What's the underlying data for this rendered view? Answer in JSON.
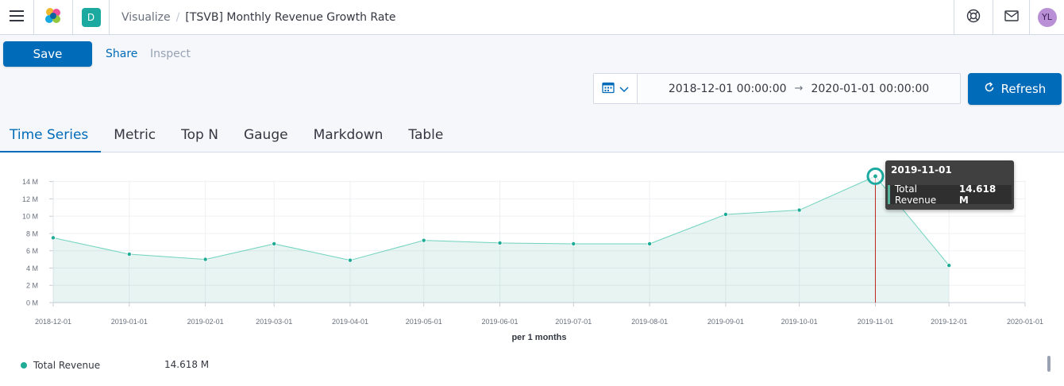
{
  "header": {
    "space_letter": "D",
    "breadcrumb": [
      "Visualize",
      "[TSVB] Monthly Revenue Growth Rate"
    ],
    "avatar_initials": "YL",
    "icons": [
      "menu-icon",
      "elastic-logo-icon",
      "help-icon",
      "mail-icon"
    ]
  },
  "toolbar": {
    "save_label": "Save",
    "share_label": "Share",
    "inspect_label": "Inspect",
    "date_start": "2018-12-01 00:00:00",
    "date_arrow": "→",
    "date_end": "2020-01-01 00:00:00",
    "refresh_label": "Refresh"
  },
  "tabs": [
    {
      "label": "Time Series",
      "active": true
    },
    {
      "label": "Metric"
    },
    {
      "label": "Top N"
    },
    {
      "label": "Gauge"
    },
    {
      "label": "Markdown"
    },
    {
      "label": "Table"
    }
  ],
  "colors": {
    "accent": "#006bb8",
    "series": "#54b399",
    "marker_line": "#bd271e"
  },
  "chart_data": {
    "type": "area",
    "x_label": "per 1 months",
    "x_ticks": [
      "2018-12-01",
      "2019-01-01",
      "2019-02-01",
      "2019-03-01",
      "2019-04-01",
      "2019-05-01",
      "2019-06-01",
      "2019-07-01",
      "2019-08-01",
      "2019-09-01",
      "2019-10-01",
      "2019-11-01",
      "2019-12-01",
      "2020-01-01"
    ],
    "y_ticks": [
      "0 M",
      "2 M",
      "4 M",
      "6 M",
      "8 M",
      "10 M",
      "12 M",
      "14 M"
    ],
    "ylim": [
      0,
      14
    ],
    "grid": true,
    "series": [
      {
        "name": "Total Revenue",
        "x": [
          "2018-12-01",
          "2019-01-01",
          "2019-02-01",
          "2019-03-01",
          "2019-04-01",
          "2019-05-01",
          "2019-06-01",
          "2019-07-01",
          "2019-08-01",
          "2019-09-01",
          "2019-10-01",
          "2019-11-01",
          "2019-12-01"
        ],
        "values": [
          7.5,
          5.6,
          5.0,
          6.8,
          4.9,
          7.2,
          6.9,
          6.8,
          6.8,
          10.2,
          10.7,
          14.618,
          4.3
        ]
      }
    ],
    "crosshair_x": "2019-11-01",
    "tooltip": {
      "date": "2019-11-01",
      "label": "Total Revenue",
      "value": "14.618 M"
    },
    "legend": [
      {
        "label": "Total Revenue",
        "value": "14.618 M"
      }
    ]
  }
}
